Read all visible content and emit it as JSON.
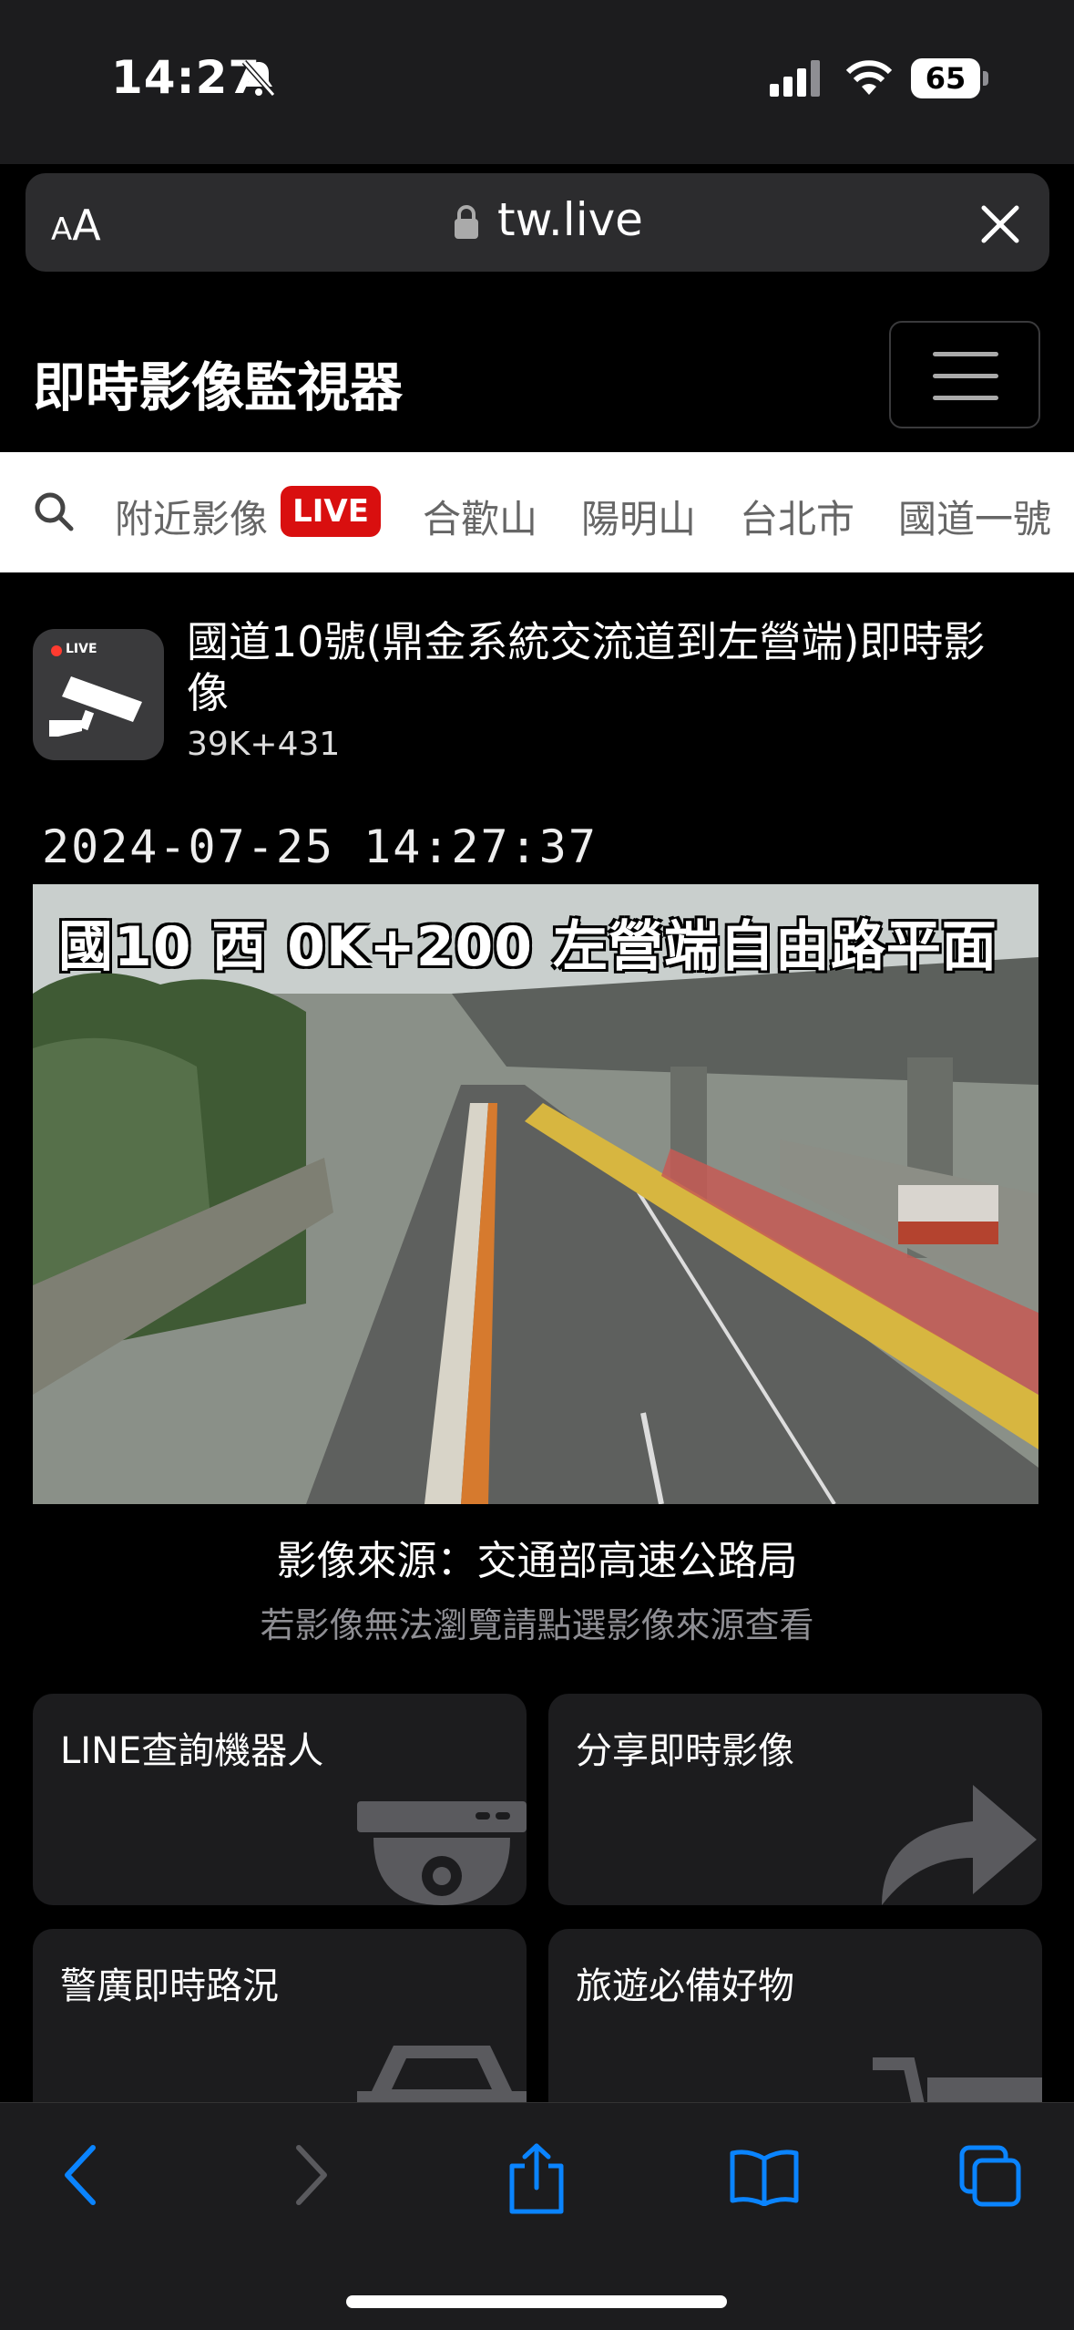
{
  "status": {
    "time": "14:27",
    "battery": "65"
  },
  "browser": {
    "text_size": "AA",
    "url": "tw.live"
  },
  "site": {
    "brand": "即時影像監視器"
  },
  "nav": {
    "live_label": "LIVE",
    "items": [
      "附近影像",
      "合歡山",
      "陽明山",
      "台北市",
      "國道一號"
    ]
  },
  "camera": {
    "badge": "LIVE",
    "title": "國道10號(鼎金系統交流道到左營端)即時影像",
    "subtitle": "39K+431",
    "timestamp": "2024-07-25 14:27:37",
    "overlay": "國10 西 0K+200 左營端自由路平面",
    "source": "影像來源：交通部高速公路局",
    "source_hint": "若影像無法瀏覽請點選影像來源查看"
  },
  "cards": [
    {
      "label": "LINE查詢機器人",
      "icon": "camera-icon"
    },
    {
      "label": "分享即時影像",
      "icon": "share-arrow-icon"
    },
    {
      "label": "警廣即時路況",
      "icon": "car-icon"
    },
    {
      "label": "旅遊必備好物",
      "icon": "cart-icon"
    }
  ],
  "colors": {
    "accent_blue": "#0a84ff",
    "live_red": "#d90f0f"
  }
}
